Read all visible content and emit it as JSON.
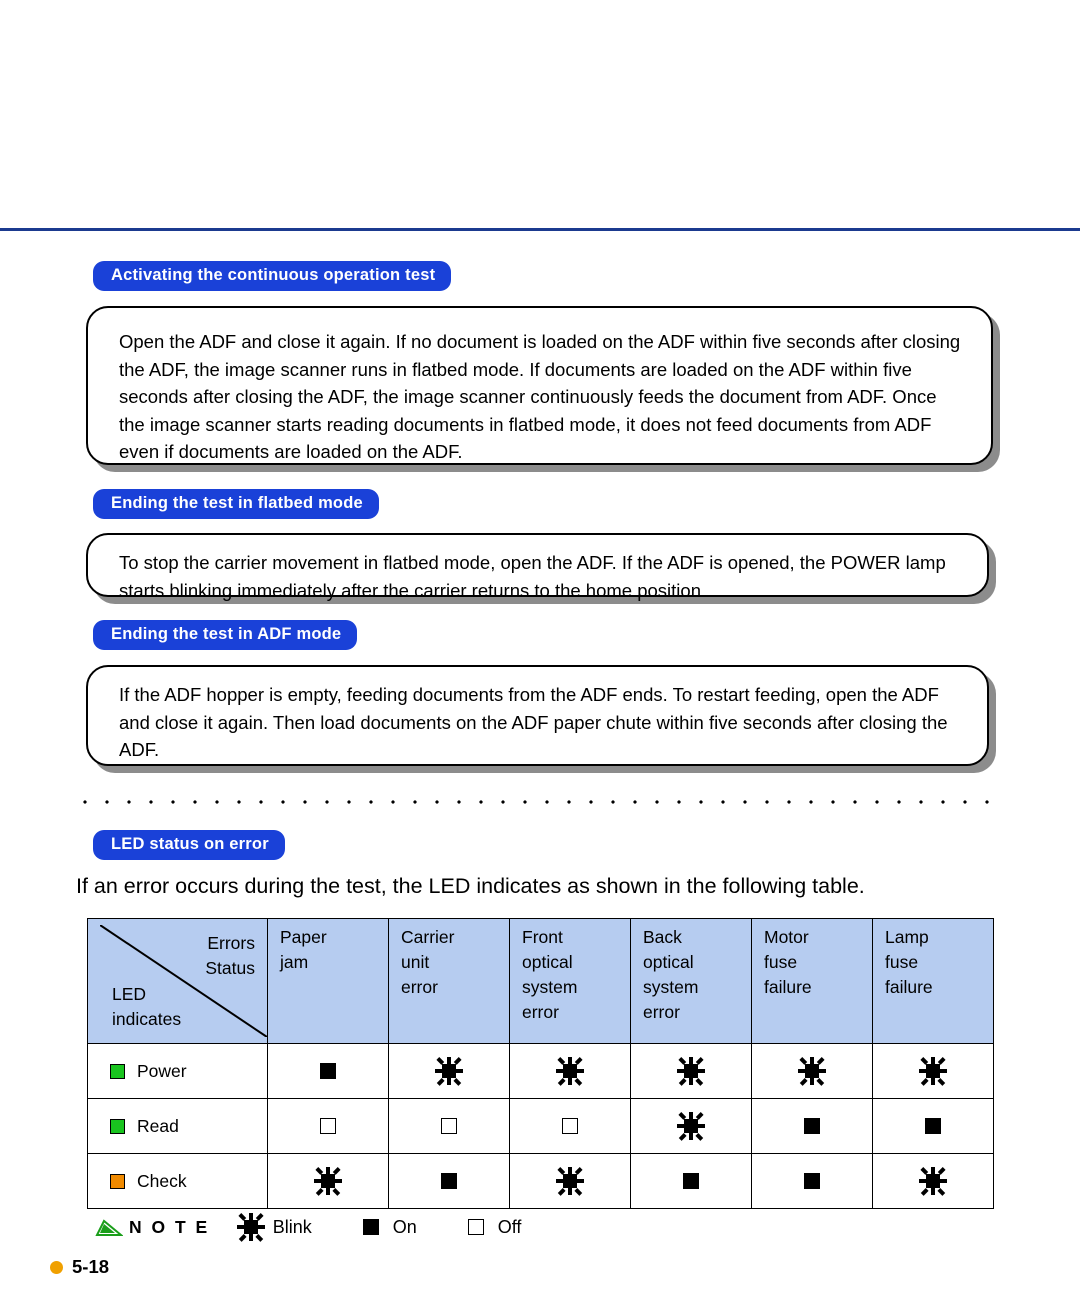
{
  "page": {
    "footer_number": "5-18"
  },
  "sections": [
    {
      "heading": "Activating the continuous operation test",
      "body": "Open the ADF and close it again.  If no document is loaded on the ADF within five seconds after closing the ADF, the image scanner runs in flatbed mode.  If documents are loaded on the ADF within five seconds after closing the ADF, the image scanner continuously feeds the document from ADF.  Once the image scanner starts reading documents in flatbed mode, it does not feed documents from ADF even if documents are loaded on the ADF."
    },
    {
      "heading": "Ending the test in flatbed mode",
      "body": "To stop the carrier movement in flatbed mode, open the ADF.  If the ADF is opened, the POWER lamp starts blinking immediately after the carrier returns to the home position."
    },
    {
      "heading": "Ending the test in ADF mode",
      "body": "If the ADF hopper is empty, feeding documents from the ADF ends.  To restart feeding, open the ADF and close it again.  Then load documents on the ADF paper  chute within five seconds after closing the ADF."
    },
    {
      "heading": "LED status on error",
      "body": "If an error occurs during the test, the LED indicates as shown in the following table."
    }
  ],
  "table": {
    "corner": {
      "errors_label": "Errors",
      "status_label": "Status",
      "led_label": "LED",
      "indicates_label": "indicates"
    },
    "columns": [
      "Paper jam",
      "Carrier unit error",
      "Front optical system error",
      "Back optical system error",
      "Motor fuse failure",
      "Lamp fuse failure"
    ],
    "column_lines": [
      [
        "Paper",
        "jam"
      ],
      [
        "Carrier",
        "unit",
        "error"
      ],
      [
        "Front",
        "optical",
        "system",
        "error"
      ],
      [
        "Back",
        "optical",
        "system",
        "error"
      ],
      [
        "Motor",
        "fuse",
        "failure"
      ],
      [
        "Lamp",
        "fuse",
        "failure"
      ]
    ],
    "rows": [
      {
        "label": "Power",
        "led_color": "#19c41f",
        "cells": [
          "on",
          "blink",
          "blink",
          "blink",
          "blink",
          "blink"
        ]
      },
      {
        "label": "Read",
        "led_color": "#19c41f",
        "cells": [
          "off",
          "off",
          "off",
          "blink",
          "on",
          "on"
        ]
      },
      {
        "label": "Check",
        "led_color": "#f08a00",
        "cells": [
          "blink",
          "on",
          "blink",
          "on",
          "on",
          "blink"
        ]
      }
    ]
  },
  "legend": {
    "note_word": "N O T E",
    "blink_label": "Blink",
    "on_label": "On",
    "off_label": "Off"
  }
}
